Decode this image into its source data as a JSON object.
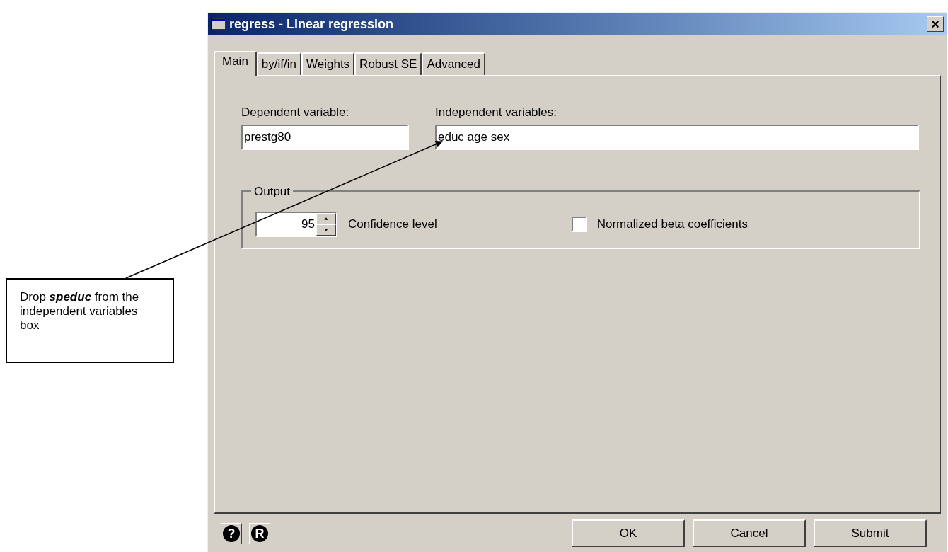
{
  "window": {
    "title": "regress - Linear regression",
    "close": "×"
  },
  "tabs": [
    {
      "label": "Main",
      "selected": true
    },
    {
      "label": "by/if/in",
      "selected": false
    },
    {
      "label": "Weights",
      "selected": false
    },
    {
      "label": "Robust SE",
      "selected": false
    },
    {
      "label": "Advanced",
      "selected": false
    }
  ],
  "dependent": {
    "label": "Dependent variable:",
    "value": "prestg80"
  },
  "independent": {
    "label": "Independent variables:",
    "value": "educ age sex"
  },
  "output": {
    "title": "Output",
    "confidence": {
      "value": "95",
      "label": "Confidence level"
    },
    "beta": {
      "label": "Normalized beta coefficients",
      "checked": false
    }
  },
  "footer_icons": [
    "?",
    "R"
  ],
  "buttons": [
    "OK",
    "Cancel",
    "Submit"
  ],
  "callout": {
    "text": "Drop **speduc** from the independent variables box"
  }
}
